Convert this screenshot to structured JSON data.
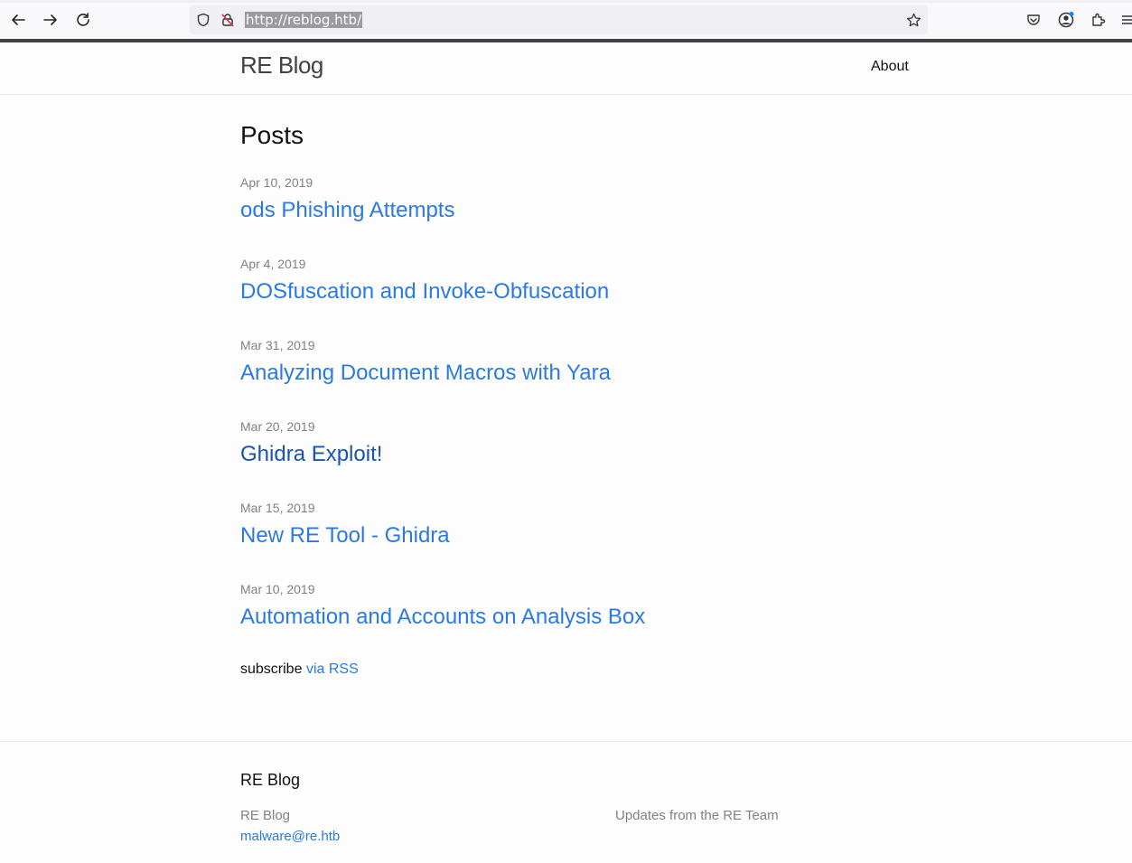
{
  "browser": {
    "url": "http://reblog.htb/",
    "icons": [
      "back-arrow-icon",
      "forward-arrow-icon",
      "reload-icon",
      "shield-icon",
      "insecure-lock-icon",
      "bookmark-star-icon",
      "pocket-icon",
      "account-icon",
      "extensions-icon",
      "menu-icon"
    ]
  },
  "header": {
    "site_title": "RE Blog",
    "nav": {
      "about": "About"
    }
  },
  "main": {
    "heading": "Posts",
    "posts": [
      {
        "date": "Apr 10, 2019",
        "title": "ods Phishing Attempts",
        "visited": false
      },
      {
        "date": "Apr 4, 2019",
        "title": "DOSfuscation and Invoke-Obfuscation",
        "visited": false
      },
      {
        "date": "Mar 31, 2019",
        "title": "Analyzing Document Macros with Yara",
        "visited": false
      },
      {
        "date": "Mar 20, 2019",
        "title": "Ghidra Exploit!",
        "visited": true
      },
      {
        "date": "Mar 15, 2019",
        "title": "New RE Tool - Ghidra",
        "visited": false
      },
      {
        "date": "Mar 10, 2019",
        "title": "Automation and Accounts on Analysis Box",
        "visited": false
      }
    ],
    "rss": {
      "prefix": "subscribe",
      "link": "via RSS"
    }
  },
  "footer": {
    "heading": "RE Blog",
    "name": "RE Blog",
    "email": "malware@re.htb",
    "description": "Updates from the RE Team"
  },
  "colors": {
    "link": "#2a7ae2",
    "link_visited": "#1756a9",
    "meta": "#828282",
    "title": "#424242"
  }
}
